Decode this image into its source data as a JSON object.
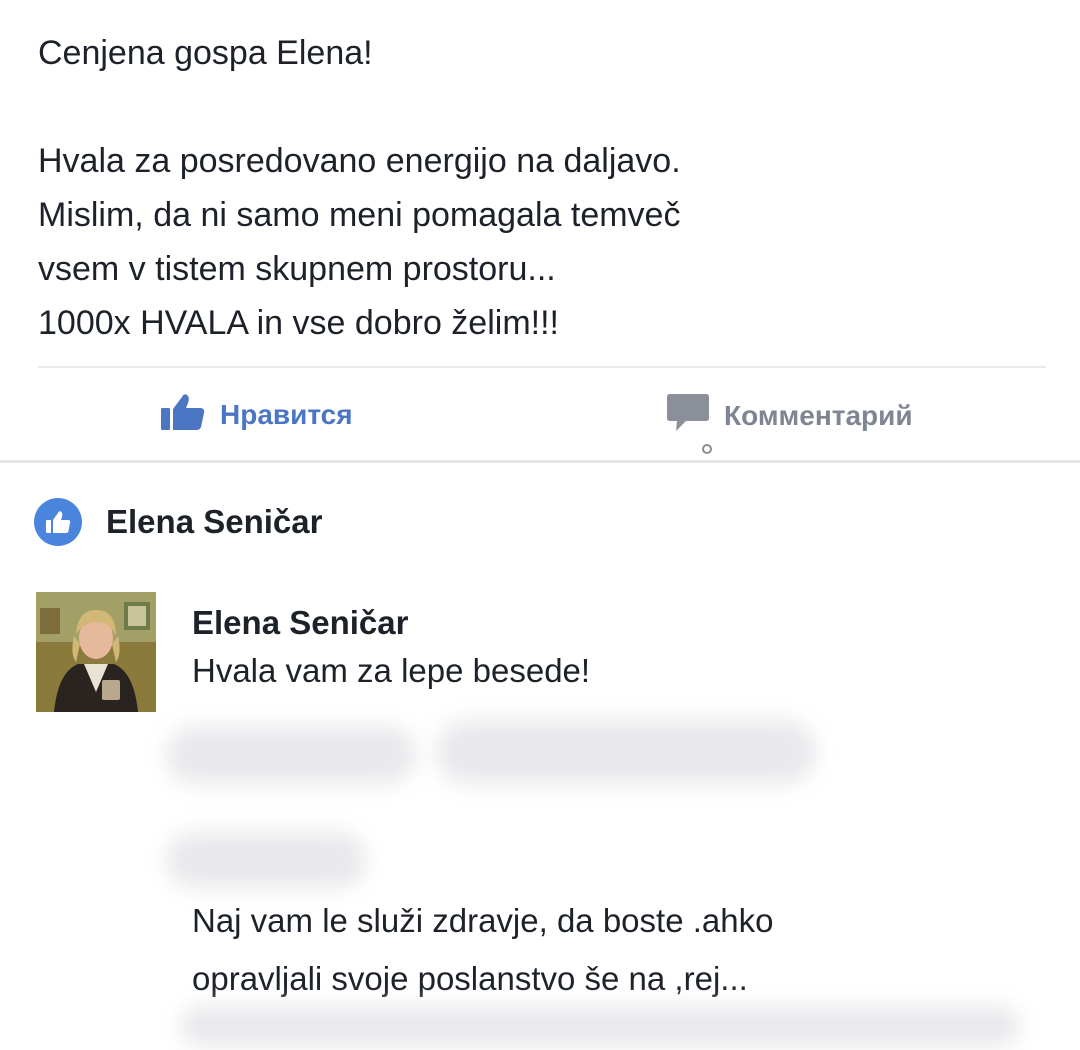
{
  "post": {
    "lines": [
      "Cenjena gospa Elena!",
      "",
      "Hvala za posredovano energijo na daljavo.",
      "Mislim, da ni samo meni pomagala temveč",
      "vsem v tistem skupnem prostoru...",
      "1000x HVALA in vse dobro želim!!!"
    ]
  },
  "actions": {
    "like_label": "Нравится",
    "comment_label": "Комментарий",
    "like_color": "#4a76c4",
    "comment_color": "#7f8592",
    "like_icon": "thumbs-up-icon",
    "comment_icon": "speech-bubble-icon"
  },
  "likes": {
    "name": "Elena Seničar",
    "icon": "like-badge-icon",
    "badge_color": "#4a84dd"
  },
  "comment": {
    "author": "Elena Seničar",
    "text": "Hvala vam za lepe besede!",
    "avatar_icon": "profile-photo"
  },
  "reply": {
    "lines": [
      "Naj vam le služi zdravje, da boste .ahko",
      "opravljali svoje poslanstvo še na ,rej..."
    ]
  }
}
